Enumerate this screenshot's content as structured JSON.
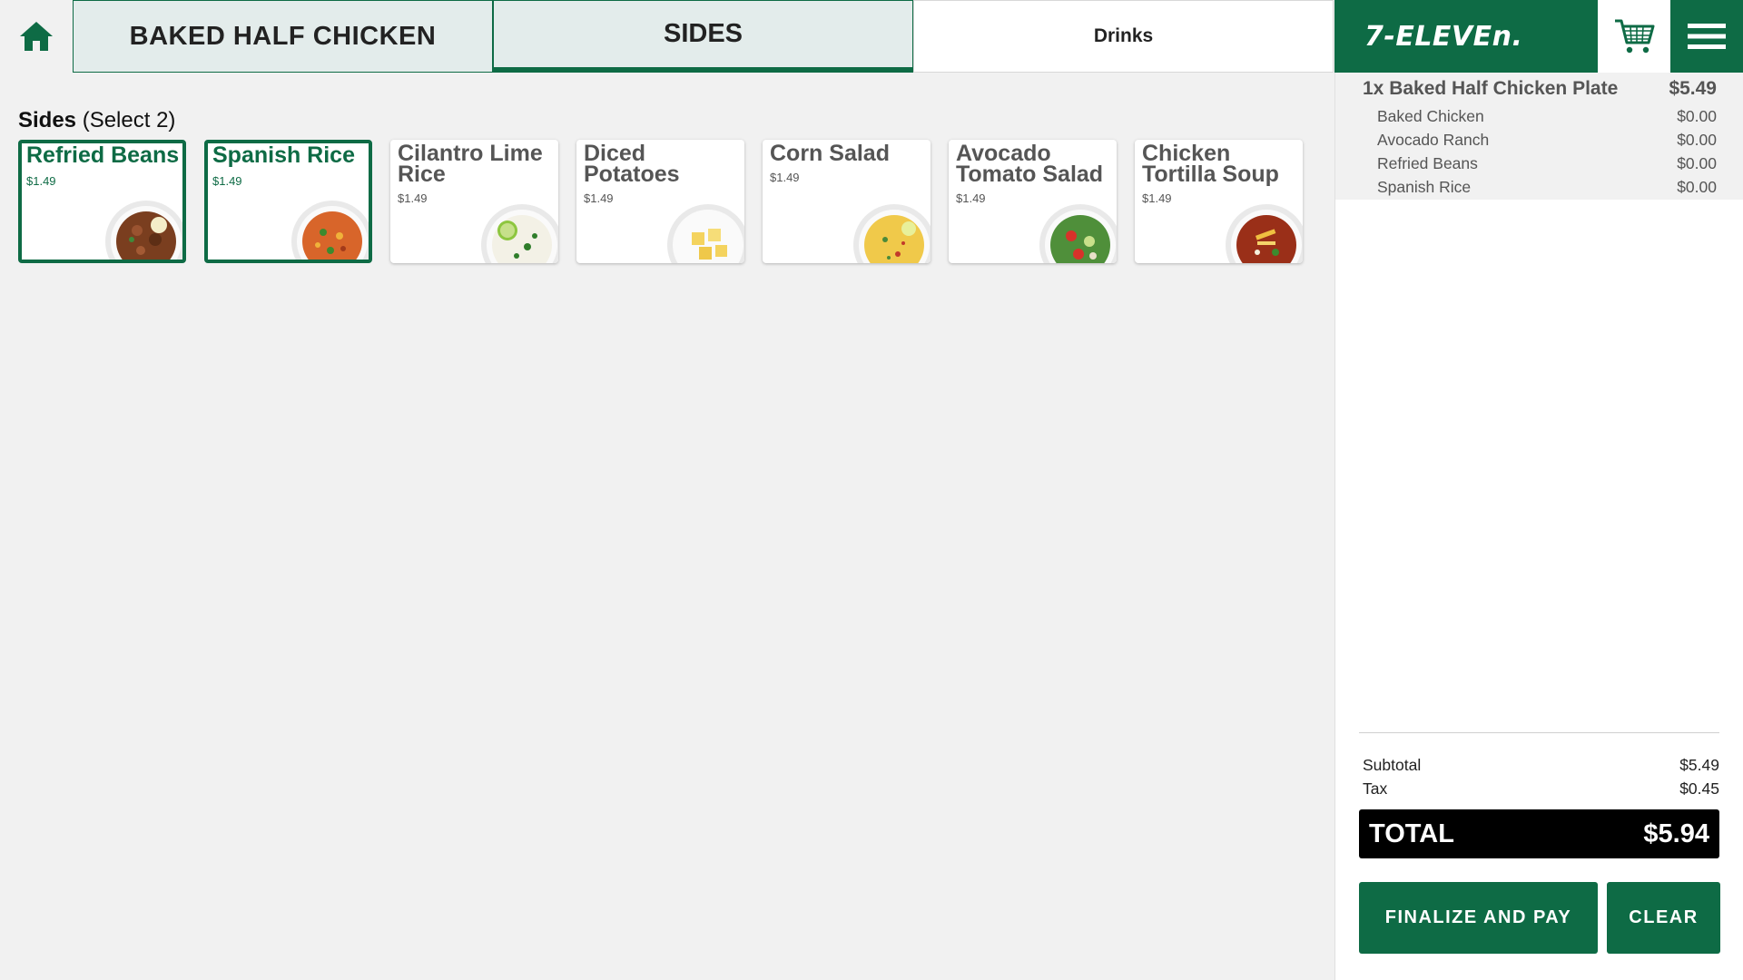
{
  "colors": {
    "brand_green": "#0e6b45",
    "tab_bg": "#e3eceb",
    "page_bg": "#f1f1f1",
    "total_bg": "#000000"
  },
  "nav": {
    "home_icon": "home-icon",
    "tabs": [
      {
        "label": "BAKED HALF CHICKEN",
        "active": false
      },
      {
        "label": "SIDES",
        "active": true
      },
      {
        "label": "Drinks",
        "active": false
      }
    ],
    "logo": "7-ELEVEn.",
    "cart_icon": "cart-icon",
    "menu_icon": "hamburger-menu-icon"
  },
  "section": {
    "title": "Sides",
    "hint": "(Select 2)"
  },
  "items": [
    {
      "name": "Refried Beans",
      "price": "$1.49",
      "selected": true,
      "icon": "refried-beans-image"
    },
    {
      "name": "Spanish Rice",
      "price": "$1.49",
      "selected": true,
      "icon": "spanish-rice-image"
    },
    {
      "name": "Cilantro Lime Rice",
      "price": "$1.49",
      "selected": false,
      "icon": "cilantro-lime-rice-image"
    },
    {
      "name": "Diced Potatoes",
      "price": "$1.49",
      "selected": false,
      "icon": "diced-potatoes-image"
    },
    {
      "name": "Corn Salad",
      "price": "$1.49",
      "selected": false,
      "icon": "corn-salad-image"
    },
    {
      "name": "Avocado Tomato Salad",
      "price": "$1.49",
      "selected": false,
      "icon": "avocado-tomato-salad-image"
    },
    {
      "name": "Chicken Tortilla Soup",
      "price": "$1.49",
      "selected": false,
      "icon": "chicken-tortilla-soup-image"
    }
  ],
  "order": {
    "main": {
      "label": "1x Baked Half Chicken Plate",
      "price": "$5.49"
    },
    "modifiers": [
      {
        "label": "Baked Chicken",
        "price": "$0.00"
      },
      {
        "label": "Avocado Ranch",
        "price": "$0.00"
      },
      {
        "label": "Refried Beans",
        "price": "$0.00"
      },
      {
        "label": "Spanish Rice",
        "price": "$0.00"
      }
    ],
    "subtotal_label": "Subtotal",
    "subtotal": "$5.49",
    "tax_label": "Tax",
    "tax": "$0.45",
    "total_label": "TOTAL",
    "total": "$5.94",
    "pay_label": "FINALIZE AND PAY",
    "clear_label": "CLEAR"
  }
}
